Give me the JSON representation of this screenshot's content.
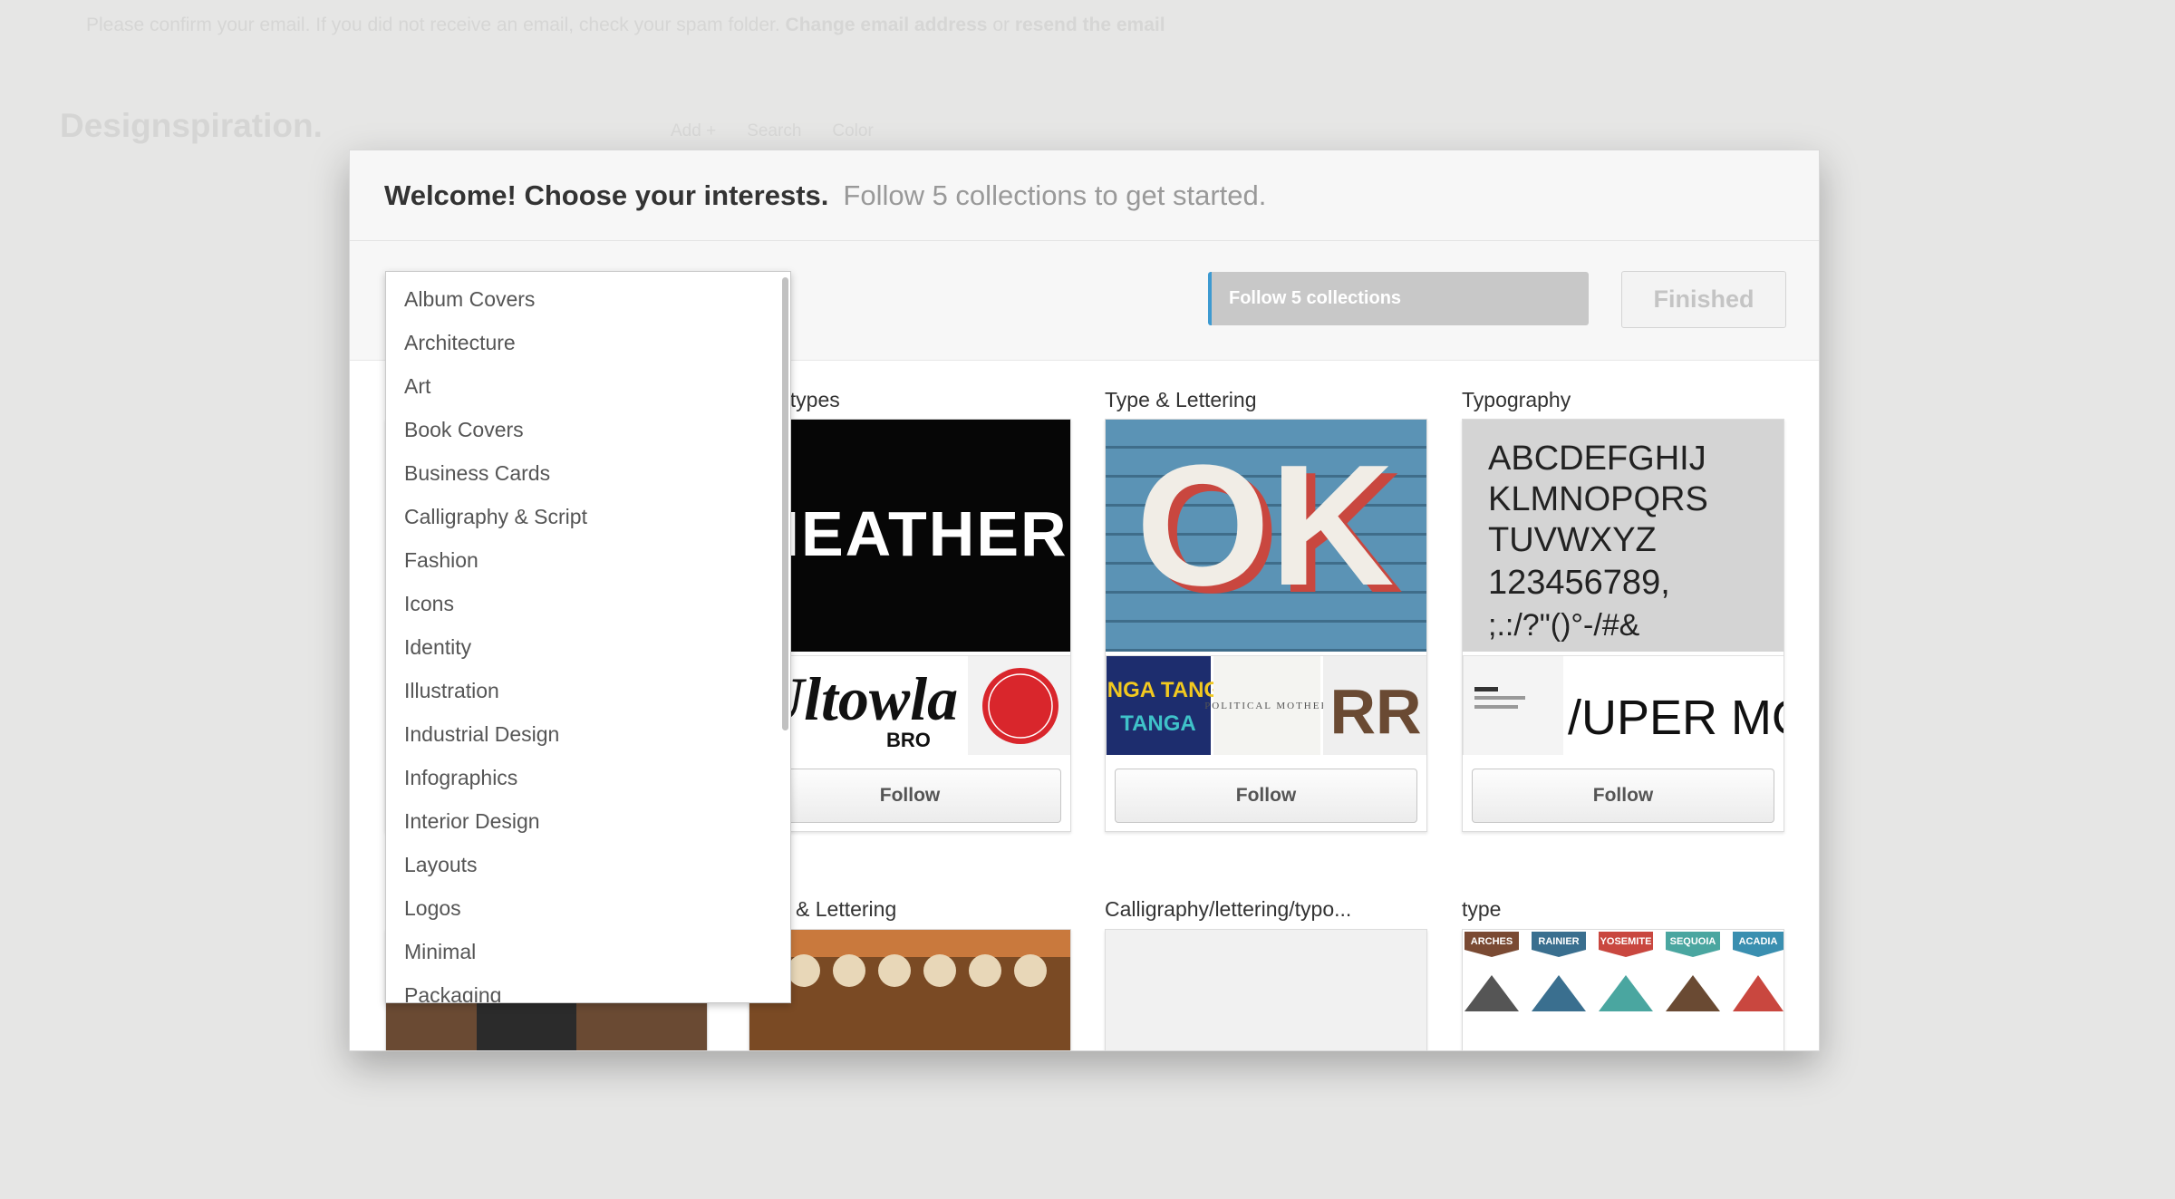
{
  "notice": {
    "text": "Please confirm your email. If you did not receive an email, check your spam folder.",
    "change_link": "Change email address",
    "or": "or",
    "resend_link": "resend the email"
  },
  "background": {
    "logo": "Designspiration.",
    "nav": [
      "Add +",
      "Search",
      "Color"
    ]
  },
  "modal": {
    "title": "Welcome! Choose your interests.",
    "subtitle": "Follow 5 collections to get started.",
    "progress_label": "Follow 5 collections",
    "progress_value": 0,
    "finished_label": "Finished"
  },
  "dropdown": {
    "items": [
      "Album Covers",
      "Architecture",
      "Art",
      "Book Covers",
      "Business Cards",
      "Calligraphy & Script",
      "Fashion",
      "Icons",
      "Identity",
      "Illustration",
      "Industrial Design",
      "Infographics",
      "Interior Design",
      "Layouts",
      "Logos",
      "Minimal",
      "Packaging"
    ]
  },
  "collections": [
    {
      "title": "otypes",
      "follow": "Follow",
      "main_text": "HEATHER",
      "thumb_text": "Ultowla",
      "thumb_sub": "BRO"
    },
    {
      "title": "Type & Lettering",
      "follow": "Follow",
      "main_text": "OK",
      "thumb_text": "TANGA TANGA",
      "thumb_mid": "POLITICAL MOTHER",
      "thumb_right": "RR"
    },
    {
      "title": "Typography",
      "follow": "Follow",
      "main_lines": [
        "ABCDEFGHIJ",
        "KLMNOPQRS",
        "TUVWXYZ",
        "123456789,",
        ";.:/?\"()°-/#&"
      ],
      "thumb_text": "/UPER MODE"
    }
  ],
  "collections_row2": [
    {
      "title": "& Lettering"
    },
    {
      "title": "Calligraphy/lettering/typo..."
    },
    {
      "title": "type",
      "badges": [
        "ARCHES",
        "RAINIER",
        "YOSEMITE",
        "SEQUOIA",
        "ACADIA"
      ]
    }
  ],
  "colors": {
    "accent": "#3d9ad1",
    "backdrop": "#e6e6e5"
  }
}
